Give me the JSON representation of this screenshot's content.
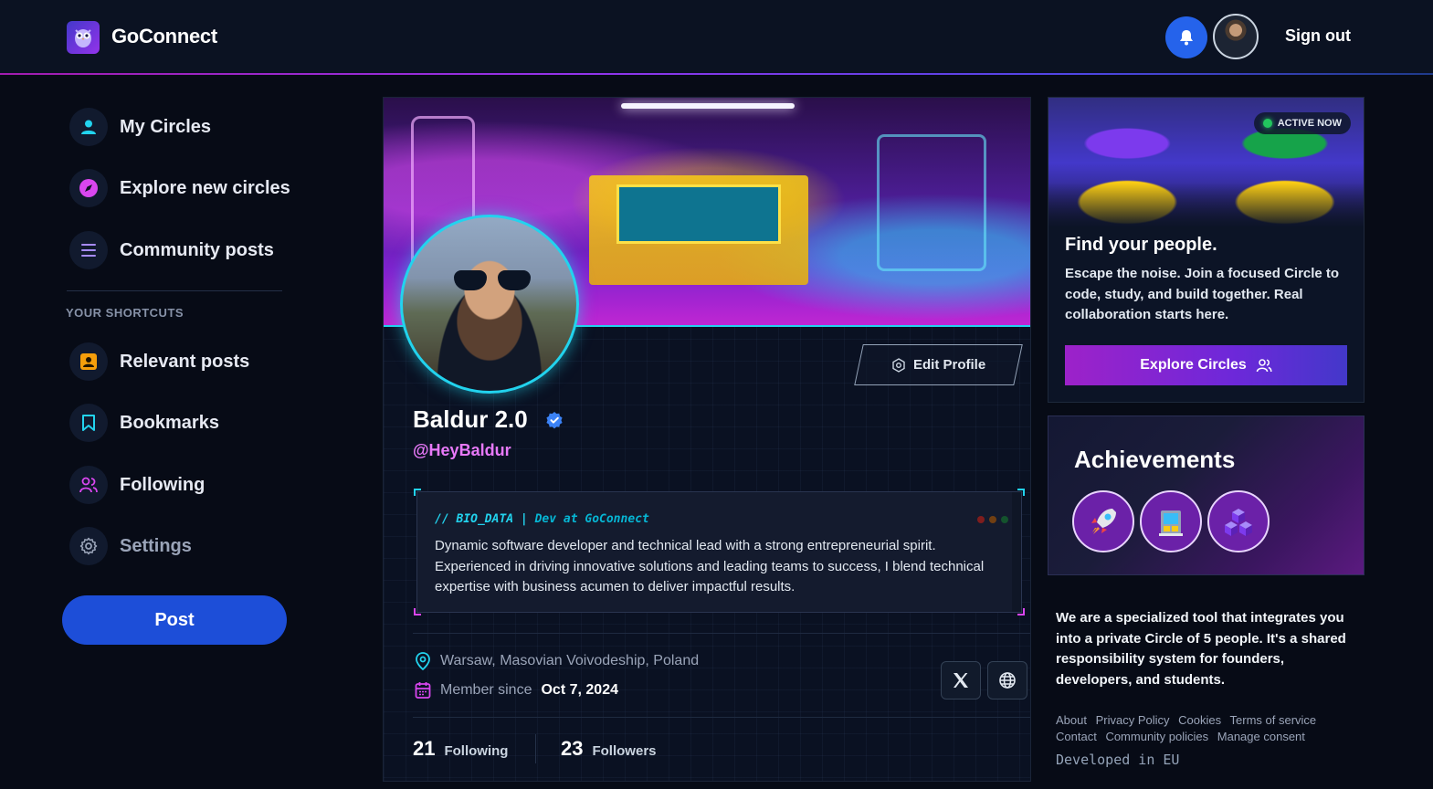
{
  "header": {
    "brand": "GoConnect",
    "sign_out": "Sign out"
  },
  "sidebar": {
    "items": [
      {
        "label": "My Circles",
        "icon": "user-icon"
      },
      {
        "label": "Explore new circles",
        "icon": "compass-icon"
      },
      {
        "label": "Community posts",
        "icon": "menu-lines-icon"
      }
    ],
    "shortcuts_heading": "YOUR SHORTCUTS",
    "shortcuts": [
      {
        "label": "Relevant posts",
        "icon": "contact-card-icon"
      },
      {
        "label": "Bookmarks",
        "icon": "bookmark-icon"
      },
      {
        "label": "Following",
        "icon": "users-icon"
      },
      {
        "label": "Settings",
        "icon": "gear-icon"
      }
    ],
    "post_button": "Post"
  },
  "profile": {
    "name": "Baldur 2.0",
    "handle": "@HeyBaldur",
    "edit_button": "Edit Profile",
    "bio_header": "// BIO_DATA |",
    "bio_subheader": "Dev at GoConnect",
    "bio_text": "Dynamic software developer and technical lead with a strong entrepreneurial spirit. Experienced in driving innovative solutions and leading teams to success, I blend technical expertise with business acumen to deliver impactful results.",
    "location": "Warsaw, Masovian Voivodeship, Poland",
    "member_since_label": "Member since",
    "member_since_date": "Oct 7, 2024",
    "following_count": "21",
    "following_label": "Following",
    "followers_count": "23",
    "followers_label": "Followers"
  },
  "promo": {
    "badge": "ACTIVE NOW",
    "title": "Find your people.",
    "text": "Escape the noise. Join a focused Circle to code, study, and build together. Real collaboration starts here.",
    "button": "Explore Circles"
  },
  "achievements": {
    "title": "Achievements",
    "badges": [
      "rocket-icon",
      "building-icon",
      "blocks-icon"
    ]
  },
  "about": {
    "text": "We are a specialized tool that integrates you into a private Circle of 5 people. It's a shared responsibility system for founders, developers, and students."
  },
  "footer": {
    "links": [
      "About",
      "Privacy Policy",
      "Cookies",
      "Terms of service",
      "Contact",
      "Community policies",
      "Manage consent"
    ],
    "developed": "Developed in EU"
  },
  "colors": {
    "accent_blue": "#1d4ed8",
    "accent_magenta": "#e879f9",
    "accent_cyan": "#22d3ee",
    "background": "#070b16"
  }
}
